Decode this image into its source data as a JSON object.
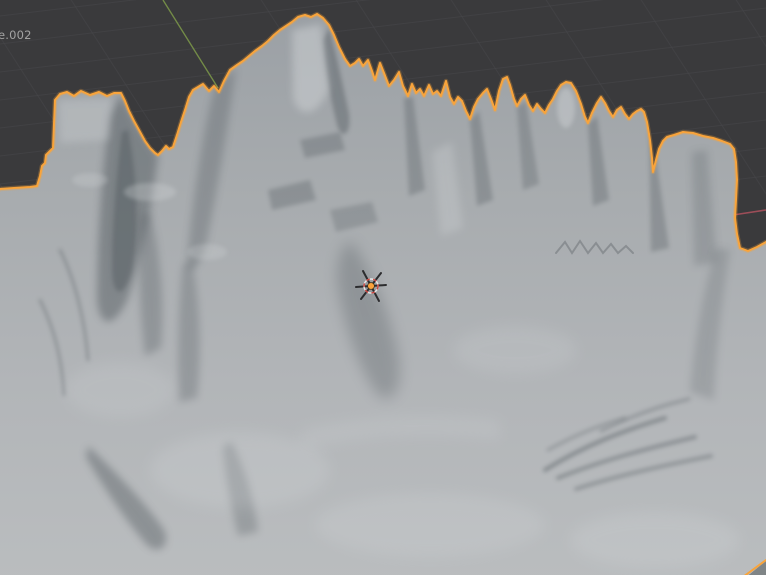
{
  "viewport": {
    "object_label": "e.002",
    "colors": {
      "background": "#3a3a3c",
      "grid_line": "#47474a",
      "selection_outline": "#f9a43b",
      "axis_y_green": "#7d9a4a",
      "axis_x_red": "#a8505c",
      "terrain_top": "#9ba0a5",
      "terrain_upper": "#a7abae",
      "terrain_lower": "#b2b5b8",
      "terrain_bottom": "#babdbf",
      "terrain_shadow": "#4e545a",
      "terrain_highlight": "#d6d9db",
      "cursor_dot_orange": "#fba23c",
      "cursor_spoke": "#2c2c2e",
      "cursor_dash_red": "#c8423c",
      "cursor_dash_white": "#e9e9e9",
      "label_text": "#a2a2a2"
    },
    "icons": {
      "cursor_gizmo": "3d-cursor-and-origin-icon",
      "axis_y": "y-axis-line",
      "axis_x": "x-axis-line"
    }
  }
}
